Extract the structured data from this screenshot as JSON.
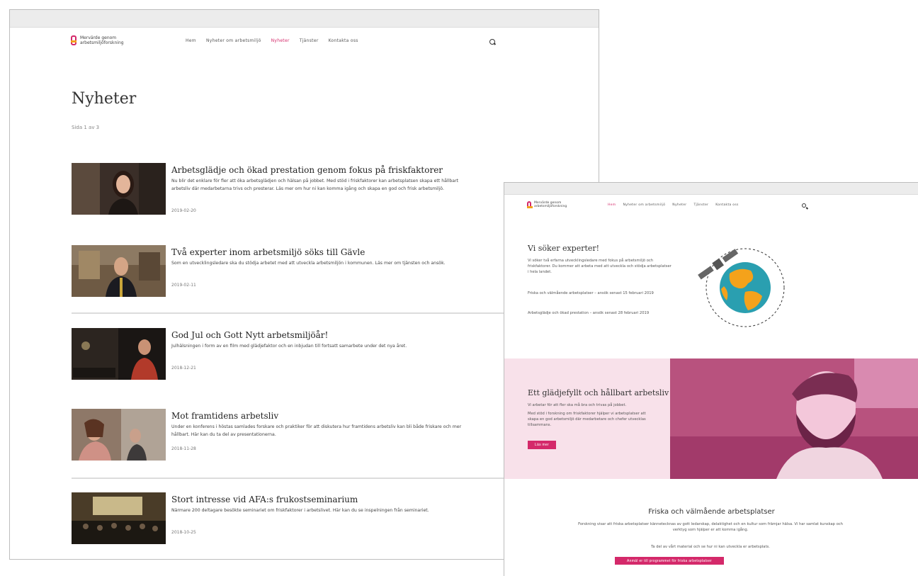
{
  "news_window": {
    "logo_lines": [
      "Mervärde genom",
      "arbetsmiljöforskning"
    ],
    "nav": [
      "Hem",
      "Nyheter om arbetsmiljö",
      "Nyheter",
      "Tjänster",
      "Kontakta oss"
    ],
    "page_title": "Nyheter",
    "subtitle": "Sida 1 av 3",
    "articles": [
      {
        "title": "Arbetsglädje och ökad prestation genom fokus på friskfaktorer",
        "excerpt": "Nu blir det enklare för fler att öka arbetsglädjen och hälsan på jobbet. Med stöd i friskfaktorer kan arbetsplatsen skapa ett hållbart arbetsliv där medarbetarna trivs och presterar. Läs mer om hur ni kan komma igång och skapa en god och frisk arbetsmiljö.",
        "date": "2019-02-20"
      },
      {
        "title": "Två experter inom arbetsmiljö söks till Gävle",
        "excerpt": "Som en utvecklingsledare ska du stödja arbetet med att utveckla arbetsmiljön i kommunen. Läs mer om tjänsten och ansök.",
        "date": "2019-02-11"
      },
      {
        "title": "God Jul och Gott Nytt arbetsmiljöår!",
        "excerpt": "Julhälsningen i form av en film med glädjefaktor och en inbjudan till fortsatt samarbete under det nya året.",
        "date": "2018-12-21"
      },
      {
        "title": "Mot framtidens arbetsliv",
        "excerpt": "Under en konferens i höstas samlades forskare och praktiker för att diskutera hur framtidens arbetsliv kan bli både friskare och mer hållbart. Här kan du ta del av presentationerna.",
        "date": "2018-11-28"
      },
      {
        "title": "Stort intresse vid AFA:s frukostseminarium",
        "excerpt": "Närmare 200 deltagare besökte seminariet om friskfaktorer i arbetslivet. Här kan du se inspelningen från seminariet.",
        "date": "2018-10-25"
      }
    ]
  },
  "home_window": {
    "logo_lines": [
      "Mervärde genom",
      "arbetsmiljöforskning"
    ],
    "nav": [
      "Hem",
      "Nyheter om arbetsmiljö",
      "Nyheter",
      "Tjänster",
      "Kontakta oss"
    ],
    "hero_title": "Vi söker experter!",
    "hero_paragraphs": [
      "Vi söker två erfarna utvecklingsledare med fokus på arbetsmiljö och friskfaktorer. Du kommer att arbeta med att utveckla och stödja arbetsplatser i hela landet.",
      "Friska och välmående arbetsplatser – ansök senast 15 februari 2019",
      "Arbetsglädje och ökad prestation – ansök senast 28 februari 2019"
    ],
    "band_title": "Ett glädjefyllt och hållbart arbetsliv",
    "band_paragraphs": [
      "Vi arbetar för att fler ska må bra och trivas på jobbet.",
      "Med stöd i forskning om friskfaktorer hjälper vi arbetsplatser att skapa en god arbetsmiljö där medarbetare och chefer utvecklas tillsammans."
    ],
    "band_button": "Läs mer",
    "bottom_title": "Friska och välmående arbetsplatser",
    "bottom_paragraphs": [
      "Forskning visar att friska arbetsplatser kännetecknas av gott ledarskap, delaktighet och en kultur som främjar hälsa. Vi har samlat kunskap och verktyg som hjälper er att komma igång.",
      "Ta del av vårt material och se hur ni kan utveckla er arbetsplats."
    ],
    "bottom_button": "Anmäl er till programmet för friska arbetsplatser"
  }
}
